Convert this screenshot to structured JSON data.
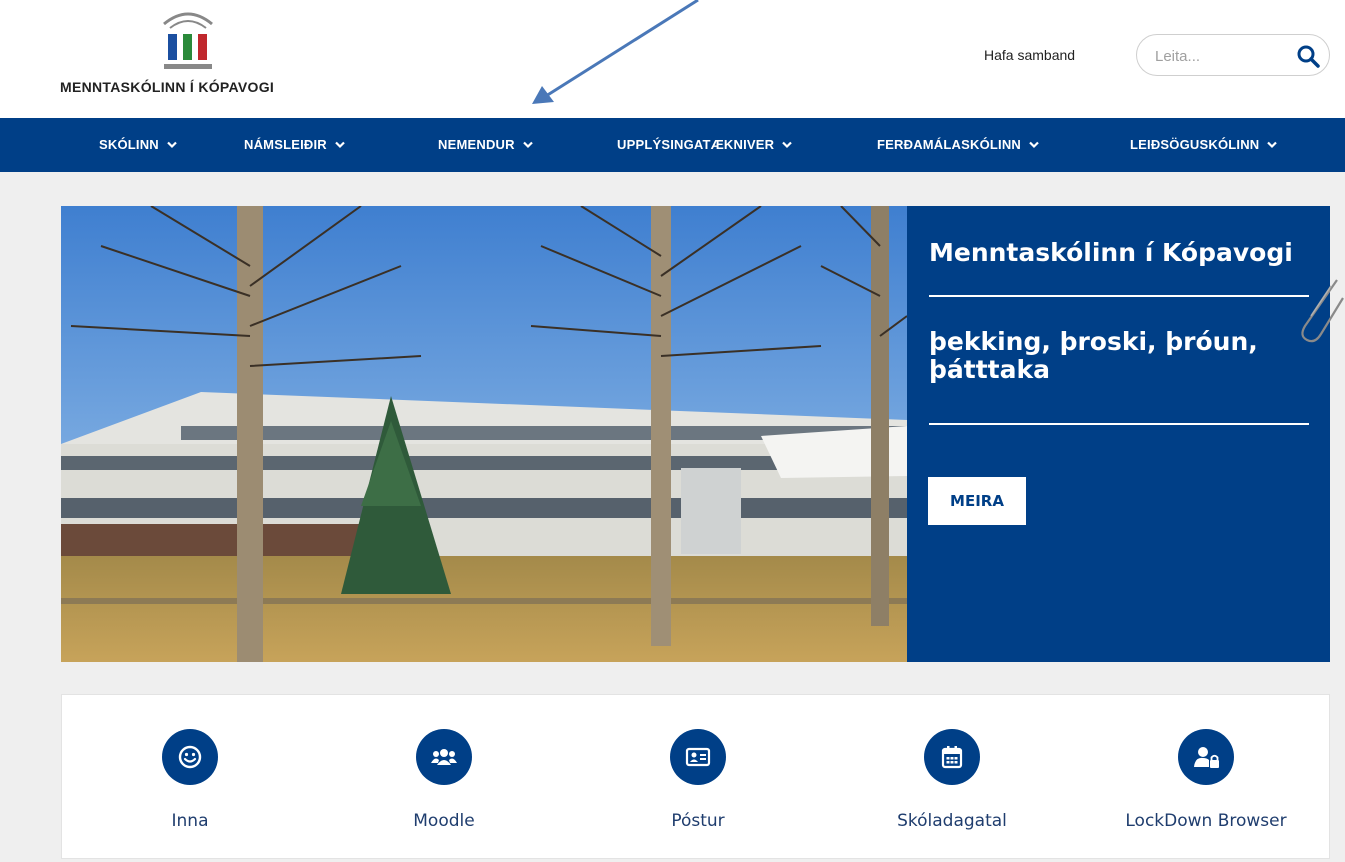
{
  "header": {
    "logo_text": "MENNTASKÓLINN Í KÓPAVOGI",
    "contact_link": "Hafa samband",
    "search_placeholder": "Leita..."
  },
  "nav": {
    "items": [
      {
        "label": "SKÓLINN"
      },
      {
        "label": "NÁMSLEIÐIR"
      },
      {
        "label": "NEMENDUR"
      },
      {
        "label": "UPPLÝSINGATÆKNIVER"
      },
      {
        "label": "FERÐAMÁLASKÓLINN"
      },
      {
        "label": "LEIÐSÖGUSKÓLINN"
      }
    ]
  },
  "hero": {
    "title": "Menntaskólinn í Kópavogi",
    "motto": "þekking, þroski, þróun, þátttaka",
    "button_label": "MEIRA"
  },
  "quick_links": [
    {
      "label": "Inna",
      "icon": "smiley-icon"
    },
    {
      "label": "Moodle",
      "icon": "users-icon"
    },
    {
      "label": "Póstur",
      "icon": "id-card-icon"
    },
    {
      "label": "Skóladagatal",
      "icon": "calendar-icon"
    },
    {
      "label": "LockDown Browser",
      "icon": "user-lock-icon"
    }
  ],
  "colors": {
    "brand_blue": "#003f87",
    "page_background": "#efefef",
    "annotation_arrow": "#4a78b8"
  }
}
